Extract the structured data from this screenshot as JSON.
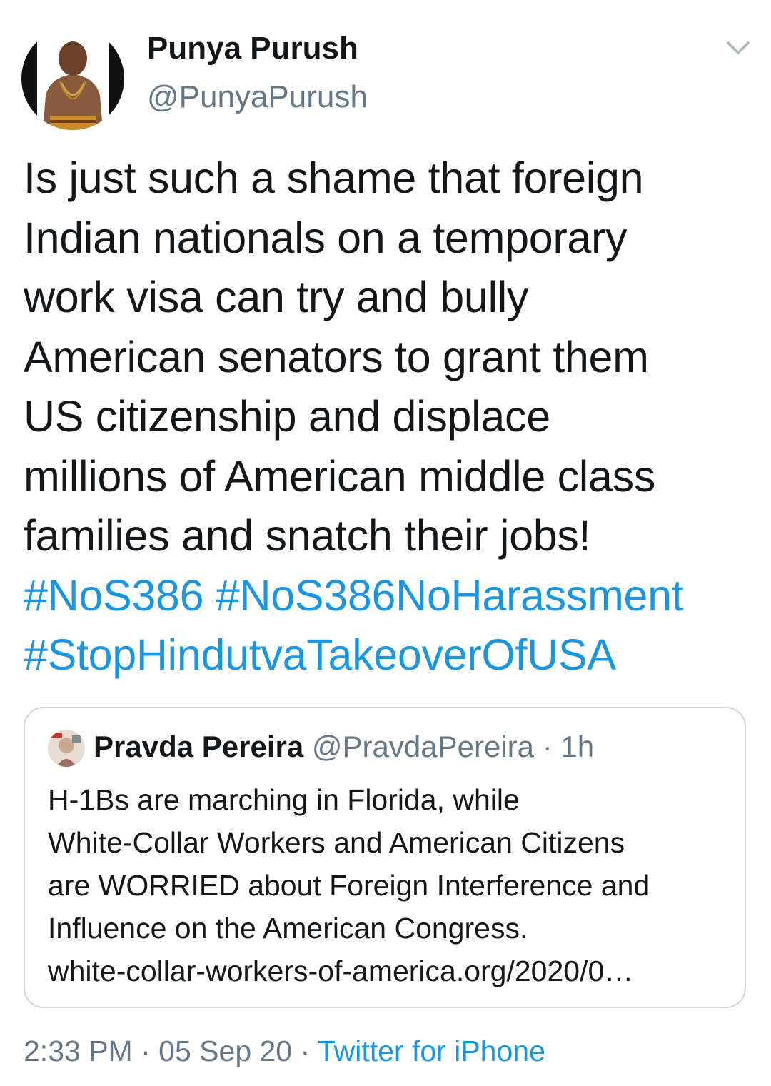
{
  "author": {
    "display_name": "Punya Purush",
    "handle": "@PunyaPurush"
  },
  "icons": {
    "menu": "chevron-down-icon",
    "avatar": "avatar"
  },
  "tweet": {
    "lines": [
      "Is just such a shame that foreign",
      "Indian nationals on a temporary",
      "work visa can try and bully",
      "American senators to grant them",
      "US citizenship and displace",
      "millions of American middle  class",
      "families and snatch their jobs!"
    ],
    "hashtag_1": "#NoS386",
    "hashtag_2": "#NoS386NoHarassment",
    "hashtag_3": "#StopHindutvaTakeoverOfUSA"
  },
  "quote": {
    "display_name": "Pravda Pereira",
    "handle": "@PravdaPereira",
    "separator": "·",
    "time": "1h",
    "lines": [
      "H-1Bs are marching in Florida, while",
      "White-Collar Workers and American Citizens",
      "are WORRIED about Foreign Interference and",
      "Influence on the American Congress.",
      "white-collar-workers-of-america.org/2020/0…"
    ]
  },
  "meta": {
    "time": "2:33 PM",
    "separator": "·",
    "date": "05 Sep 20",
    "source": "Twitter for iPhone"
  },
  "colors": {
    "link": "#1b95e0",
    "secondary_text": "#657786",
    "primary_text": "#14171a",
    "border": "#ccd6dd"
  }
}
